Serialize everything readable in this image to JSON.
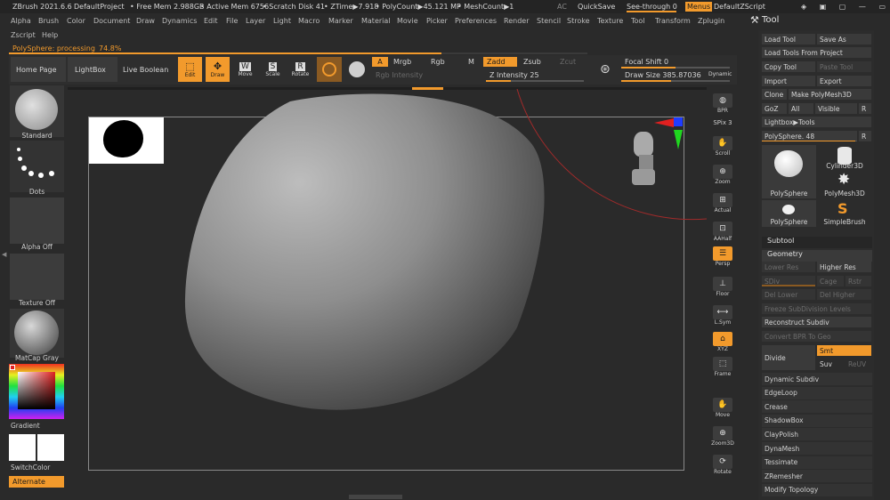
{
  "titlebar": {
    "app": "ZBrush 2021.6.6",
    "project": "DefaultProject",
    "free_mem": "• Free Mem 2.988GB",
    "active_mem": "• Active Mem 6756",
    "scratch": "• Scratch Disk 41",
    "ztime": "• ZTime▶7.918",
    "polycount": "• PolyCount▶45.121 MP",
    "meshcount": "• MeshCount▶1",
    "ac": "AC",
    "quicksave": "QuickSave",
    "seethrough": "See-through  0",
    "menus": "Menus",
    "zscript": "DefaultZScript"
  },
  "menubar": [
    "Alpha",
    "Brush",
    "Color",
    "Document",
    "Draw",
    "Dynamics",
    "Edit",
    "File",
    "Layer",
    "Light",
    "Macro",
    "Marker",
    "Material",
    "Movie",
    "Picker",
    "Preferences",
    "Render",
    "Stencil",
    "Stroke",
    "Texture",
    "Tool",
    "Transform",
    "Zplugin"
  ],
  "menubar2": [
    "Zscript",
    "Help"
  ],
  "status": {
    "label": "PolySphere: processing",
    "percent": "74.8%",
    "progress": 0.748
  },
  "shelf": {
    "home": "Home Page",
    "lightbox": "LightBox",
    "liveboolean": "Live Boolean",
    "edit": "Edit",
    "draw": "Draw",
    "move": "Move",
    "scale": "Scale",
    "rotate": "Rotate",
    "a": "A",
    "mrgb": "Mrgb",
    "rgb": "Rgb",
    "m": "M",
    "zadd": "Zadd",
    "zsub": "Zsub",
    "zcut": "Zcut",
    "rgb_intensity": "Rgb Intensity",
    "z_intensity": "Z Intensity 25",
    "focal_shift": "Focal Shift 0",
    "draw_size": "Draw Size 385.87036",
    "dynamic": "Dynamic",
    "z_intensity_value": 25,
    "focal_shift_value": 0,
    "draw_size_value": 385.87036
  },
  "leftpanel": {
    "standard": "Standard",
    "dots": "Dots",
    "alpha": "Alpha Off",
    "texture": "Texture Off",
    "matcap": "MatCap Gray",
    "gradient": "Gradient",
    "switchcolor": "SwitchColor",
    "alternate": "Alternate"
  },
  "righttoolbar": [
    {
      "label": "BPR",
      "icon": "bpr-icon"
    },
    {
      "label": "SPix 3",
      "icon": "spix-icon"
    },
    {
      "label": "Scroll",
      "icon": "scroll-icon"
    },
    {
      "label": "Zoom",
      "icon": "zoom-icon"
    },
    {
      "label": "Actual",
      "icon": "actual-icon"
    },
    {
      "label": "AAHalf",
      "icon": "aahalf-icon"
    },
    {
      "label": "Persp",
      "icon": "persp-icon"
    },
    {
      "label": "Floor",
      "icon": "floor-icon"
    },
    {
      "label": "L.Sym",
      "icon": "lsym-icon"
    },
    {
      "label": "XYZ",
      "icon": "xyz-icon"
    },
    {
      "label": "Frame",
      "icon": "frame-icon"
    },
    {
      "label": "Move",
      "icon": "move-icon"
    },
    {
      "label": "Zoom3D",
      "icon": "zoom3d-icon"
    },
    {
      "label": "Rotate",
      "icon": "rotate-icon"
    }
  ],
  "toolpanel": {
    "title": "Tool",
    "load_tool": "Load Tool",
    "save_as": "Save As",
    "load_from_project": "Load Tools From Project",
    "copy_tool": "Copy Tool",
    "paste_tool": "Paste Tool",
    "import": "Import",
    "export": "Export",
    "clone": "Clone",
    "make_polymesh": "Make PolyMesh3D",
    "goz": "GoZ",
    "all": "All",
    "visible": "Visible",
    "r": "R",
    "lightbox_tools": "Lightbox▶Tools",
    "polysphere_slider": "PolySphere. 48",
    "polysphere_slider_value": 48,
    "tools": [
      "PolySphere",
      "Cylinder3D",
      "PolyMesh3D",
      "PolySphere",
      "SimpleBrush"
    ],
    "subtool": "Subtool",
    "geometry": "Geometry",
    "lower_res": "Lower Res",
    "higher_res": "Higher Res",
    "sdiv": "SDiv",
    "cage": "Cage",
    "rstr": "Rstr",
    "del_lower": "Del Lower",
    "del_higher": "Del Higher",
    "freeze": "Freeze SubDivision Levels",
    "reconstruct": "Reconstruct Subdiv",
    "convert_bpr": "Convert BPR To Geo",
    "divide": "Divide",
    "smt": "Smt",
    "suv": "Suv",
    "reuv": "ReUV",
    "list": [
      "Dynamic Subdiv",
      "EdgeLoop",
      "Crease",
      "ShadowBox",
      "ClayPolish",
      "DynaMesh",
      "Tessimate",
      "ZRemesher",
      "Modify Topology"
    ]
  }
}
